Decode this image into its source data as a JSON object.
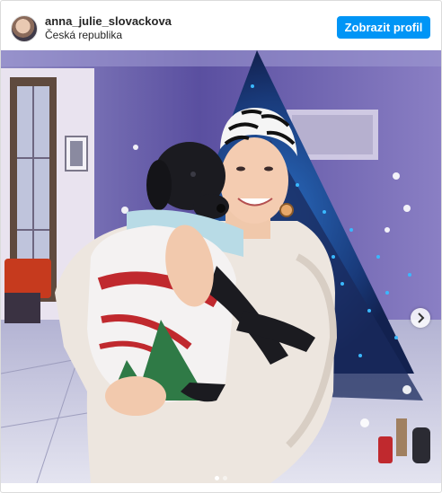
{
  "header": {
    "username": "anna_julie_slovackova",
    "location": "Česká republika",
    "profile_button_label": "Zobrazit profil"
  },
  "media": {
    "slide_count": 2,
    "current_slide": 1,
    "next_icon": "chevron-right-icon"
  },
  "colors": {
    "button_blue": "#0095f6",
    "wall_purple": "#5a4fa0",
    "tree_lights": "#3ab8ff",
    "sweater_red": "#c0292e",
    "sweater_green": "#2f7a46"
  }
}
